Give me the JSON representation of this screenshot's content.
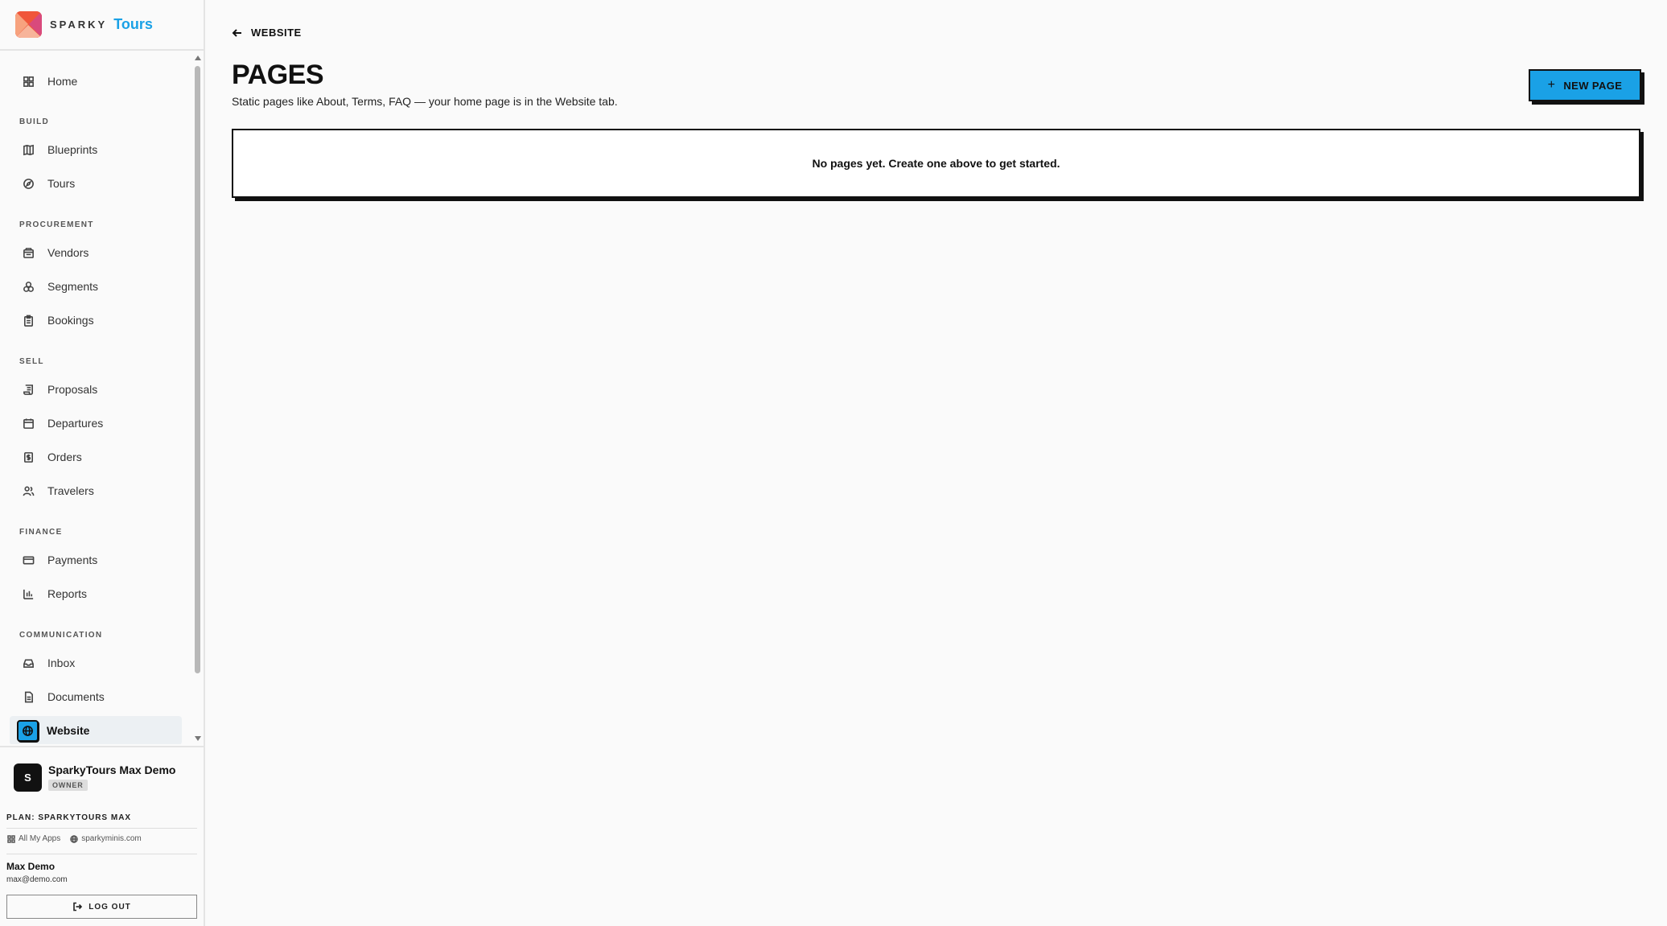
{
  "brand": {
    "word": "SPARKY",
    "accent": "Tours",
    "accent_color": "#1aa1e6"
  },
  "sidebar": {
    "items": [
      {
        "label": "Home",
        "icon": "grid-icon"
      },
      {
        "section": "BUILD"
      },
      {
        "label": "Blueprints",
        "icon": "map-icon"
      },
      {
        "label": "Tours",
        "icon": "compass-icon"
      },
      {
        "section": "PROCUREMENT"
      },
      {
        "label": "Vendors",
        "icon": "building-icon"
      },
      {
        "label": "Segments",
        "icon": "circles-icon"
      },
      {
        "label": "Bookings",
        "icon": "clipboard-icon"
      },
      {
        "section": "SELL"
      },
      {
        "label": "Proposals",
        "icon": "scroll-icon"
      },
      {
        "label": "Departures",
        "icon": "calendar-icon"
      },
      {
        "label": "Orders",
        "icon": "dollar-icon"
      },
      {
        "label": "Travelers",
        "icon": "users-icon"
      },
      {
        "section": "FINANCE"
      },
      {
        "label": "Payments",
        "icon": "credit-card-icon"
      },
      {
        "label": "Reports",
        "icon": "bar-chart-icon"
      },
      {
        "section": "COMMUNICATION"
      },
      {
        "label": "Inbox",
        "icon": "inbox-icon"
      },
      {
        "label": "Documents",
        "icon": "document-icon"
      },
      {
        "label": "Website",
        "icon": "globe-icon",
        "active": true
      }
    ]
  },
  "account": {
    "org_initial": "S",
    "org_name": "SparkyTours Max Demo",
    "org_role": "OWNER",
    "plan": "PLAN: SPARKYTOURS MAX",
    "link_apps": "All My Apps",
    "link_site": "sparkyminis.com",
    "user_name": "Max Demo",
    "user_email": "max@demo.com",
    "logout_label": "LOG OUT"
  },
  "main": {
    "back_label": "WEBSITE",
    "title": "PAGES",
    "subtitle": "Static pages like About, Terms, FAQ — your home page is in the Website tab.",
    "new_button": "NEW PAGE",
    "empty_message": "No pages yet. Create one above to get started."
  }
}
